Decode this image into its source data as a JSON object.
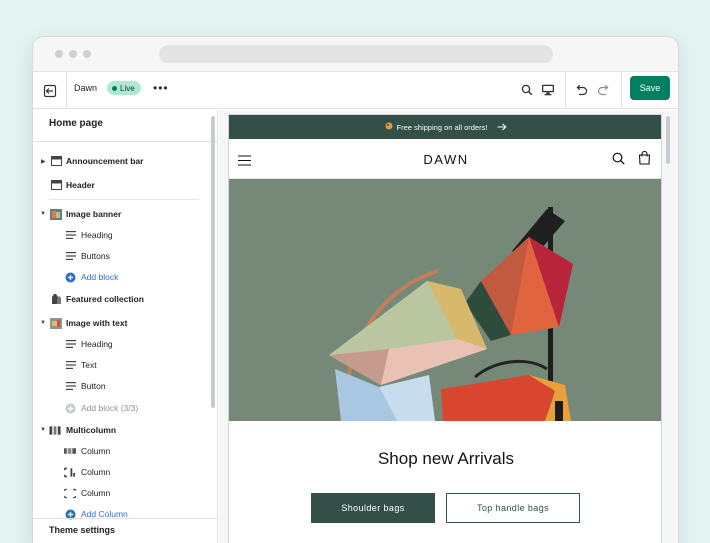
{
  "toolbar": {
    "theme_name": "Dawn",
    "status_badge": "Live",
    "more_label": "•••",
    "save_label": "Save"
  },
  "sidebar": {
    "page_title": "Home page",
    "sections": {
      "announcement_bar": "Announcement bar",
      "header": "Header",
      "image_banner": "Image banner",
      "image_banner_blocks": [
        "Heading",
        "Buttons"
      ],
      "image_banner_add": "Add block",
      "featured_collection": "Featured collection",
      "image_with_text": "Image with text",
      "image_with_text_blocks": [
        "Heading",
        "Text",
        "Button"
      ],
      "image_with_text_add": "Add block (3/3)",
      "multicolumn": "Multicolumn",
      "multicolumn_blocks": [
        "Column",
        "Column",
        "Column"
      ],
      "multicolumn_add": "Add Column"
    },
    "theme_settings": "Theme settings"
  },
  "preview": {
    "announcement": "Free shipping on all orders!",
    "logo": "DAWN",
    "heading": "Shop new Arrivals",
    "button_primary": "Shoulder bags",
    "button_secondary": "Top handle bags"
  },
  "colors": {
    "accent": "#008060",
    "store_primary": "#334f47",
    "link": "#2c6ecb",
    "live_badge": "#aee9d1",
    "hero_background": "#728474"
  },
  "icons": [
    "exit-icon",
    "search-icon",
    "desktop-icon",
    "undo-icon",
    "redo-icon",
    "menu-icon",
    "cart-icon",
    "arrow-right-icon",
    "plus-circle-icon",
    "text-block-icon",
    "section-icon"
  ]
}
